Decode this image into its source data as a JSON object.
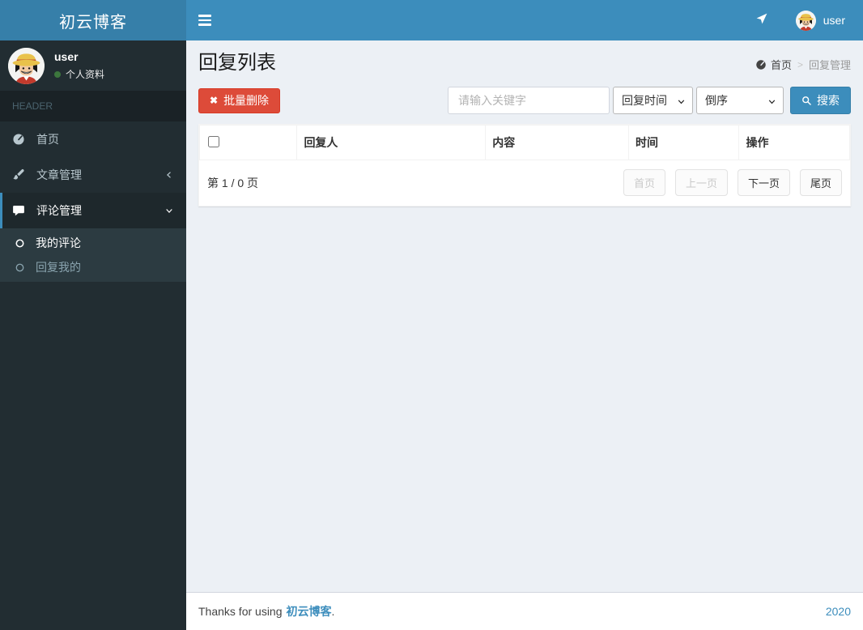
{
  "app": {
    "logo_title": "初云博客"
  },
  "navbar": {
    "username": "user"
  },
  "sidebar": {
    "user": {
      "name": "user",
      "profile_label": "个人资料"
    },
    "section_header": "HEADER",
    "items": [
      {
        "label": "首页"
      },
      {
        "label": "文章管理"
      },
      {
        "label": "评论管理"
      }
    ],
    "submenu": [
      {
        "label": "我的评论"
      },
      {
        "label": "回复我的"
      }
    ]
  },
  "page": {
    "title": "回复列表",
    "breadcrumb": {
      "home": "首页",
      "separator": ">",
      "current": "回复管理"
    }
  },
  "toolbar": {
    "batch_delete_label": "批量删除",
    "delete_icon_glyph": "✖",
    "search_placeholder": "请输入关键字",
    "filter_selected": "回复时间",
    "order_selected": "倒序",
    "search_label": "搜索"
  },
  "table": {
    "columns": [
      "回复人",
      "内容",
      "时间",
      "操作"
    ],
    "rows": []
  },
  "pagination": {
    "page_info": "第 1 / 0 页",
    "first": "首页",
    "prev": "上一页",
    "next": "下一页",
    "last": "尾页"
  },
  "footer": {
    "thanks_text": "Thanks for using",
    "brand": "初云博客",
    "period": ".",
    "year": "2020"
  },
  "colors": {
    "navbar": "#3c8dbc",
    "logo_bg": "#367fa9",
    "sidebar_bg": "#222d32",
    "sidebar_active_bg": "#1e282c",
    "submenu_bg": "#2c3b41",
    "content_bg": "#ecf0f5",
    "danger": "#dd4b39",
    "accent": "#3c8dbc",
    "online_dot": "#3c763d"
  }
}
